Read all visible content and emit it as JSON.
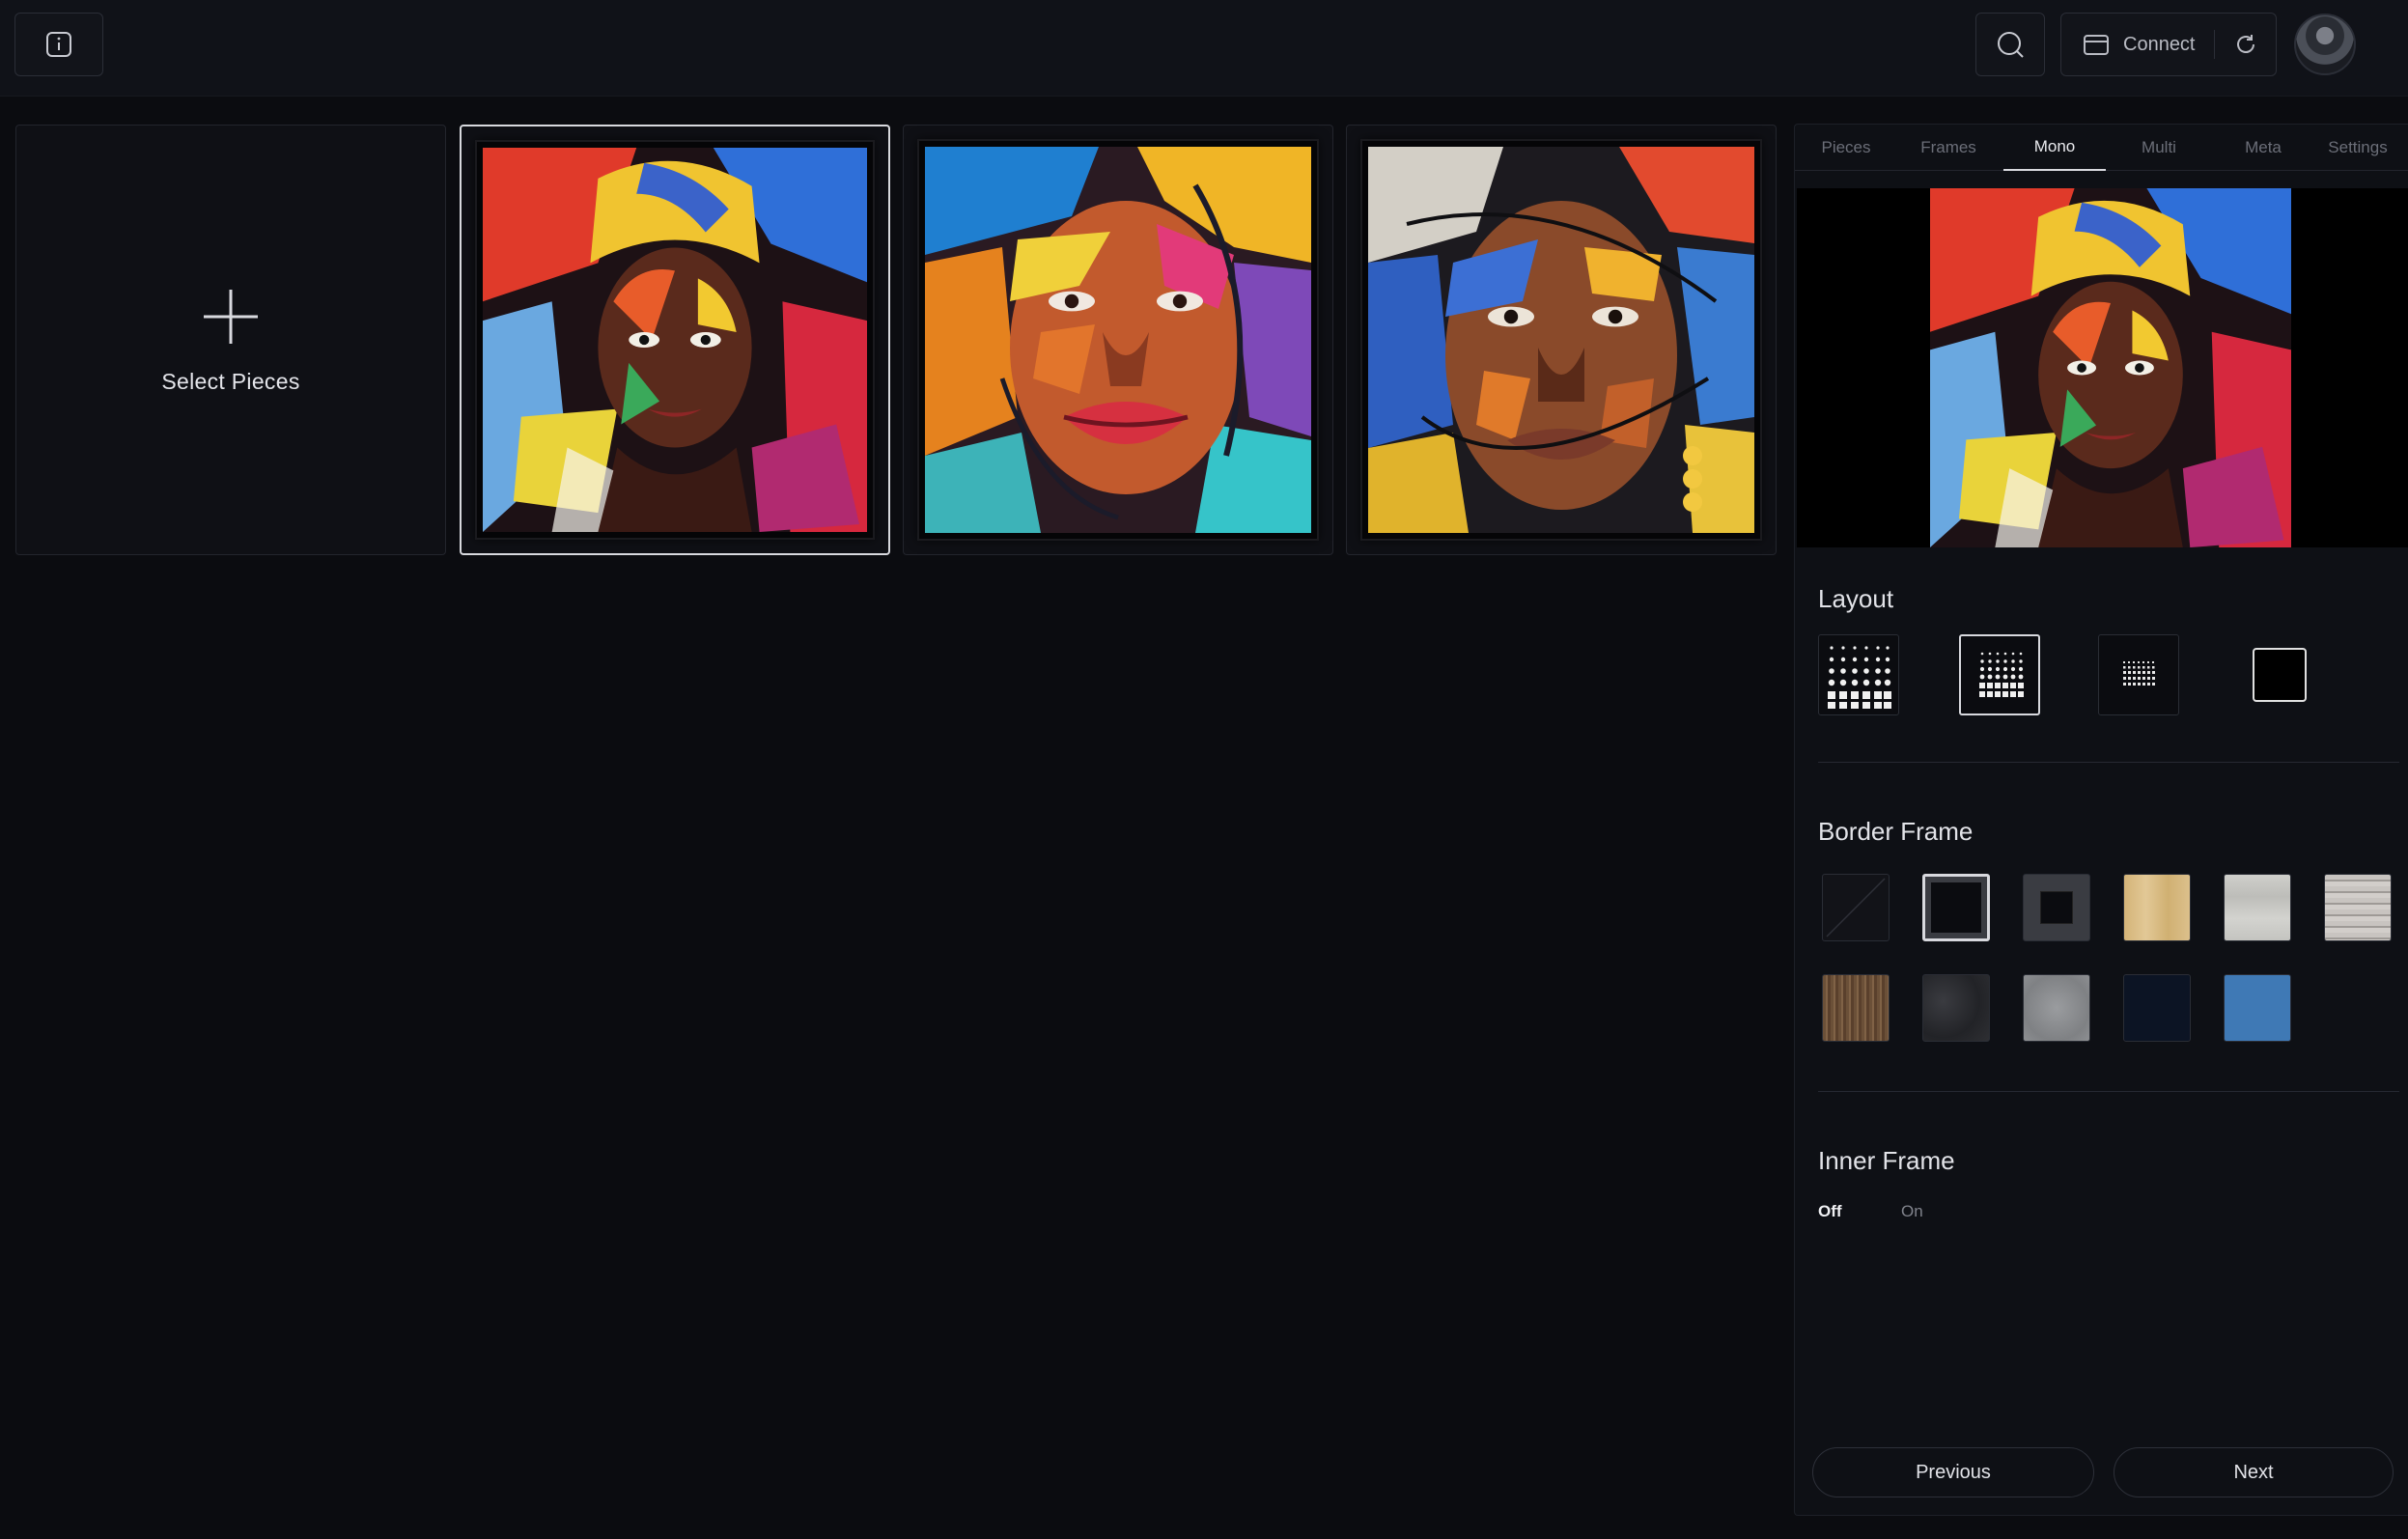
{
  "topbar": {
    "connect_label": "Connect"
  },
  "gallery": {
    "select_pieces_label": "Select Pieces",
    "pieces": [
      {
        "selected": true
      },
      {
        "selected": false
      },
      {
        "selected": false
      }
    ]
  },
  "panel": {
    "tabs": [
      "Pieces",
      "Frames",
      "Mono",
      "Multi",
      "Meta",
      "Settings"
    ],
    "active_tab": "Mono",
    "layout": {
      "title": "Layout",
      "options": [
        "dense-grid",
        "medium-grid",
        "small-grid",
        "single"
      ],
      "selected_index": 1
    },
    "border_frame": {
      "title": "Border Frame",
      "swatches": [
        {
          "name": "none",
          "color": "#121318"
        },
        {
          "name": "black",
          "color": "#0b0c10"
        },
        {
          "name": "charcoal",
          "color": "#3a3c42"
        },
        {
          "name": "light-oak",
          "color": "#d9bd84"
        },
        {
          "name": "light-grey-wood",
          "color": "#c9c9c6"
        },
        {
          "name": "whitewash-wood",
          "color": "#b9b6b2"
        },
        {
          "name": "walnut",
          "color": "#6b5038"
        },
        {
          "name": "dark-marble",
          "color": "#2c2d31"
        },
        {
          "name": "grey-stone",
          "color": "#8d8f92"
        },
        {
          "name": "navy",
          "color": "#0c1424"
        },
        {
          "name": "blue",
          "color": "#3f79b5"
        }
      ],
      "selected_index": 1
    },
    "inner_frame": {
      "title": "Inner Frame",
      "off_label": "Off",
      "on_label": "On",
      "value": "Off"
    },
    "previous_label": "Previous",
    "next_label": "Next"
  }
}
